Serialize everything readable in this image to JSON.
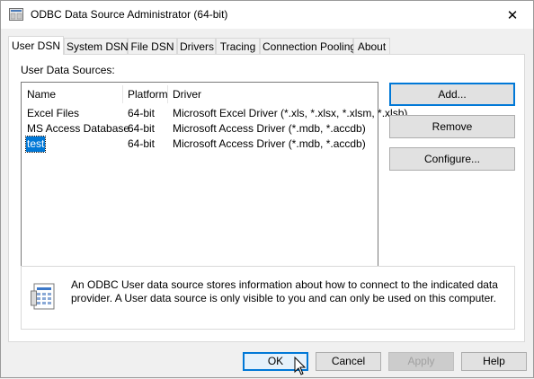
{
  "window": {
    "title": "ODBC Data Source Administrator (64-bit)",
    "close_label": "✕"
  },
  "tabs": [
    {
      "label": "User DSN",
      "active": true
    },
    {
      "label": "System DSN",
      "active": false
    },
    {
      "label": "File DSN",
      "active": false
    },
    {
      "label": "Drivers",
      "active": false
    },
    {
      "label": "Tracing",
      "active": false
    },
    {
      "label": "Connection Pooling",
      "active": false
    },
    {
      "label": "About",
      "active": false
    }
  ],
  "panel": {
    "section_label": "User Data Sources:",
    "columns": [
      "Name",
      "Platform",
      "Driver"
    ],
    "rows": [
      {
        "name": "Excel Files",
        "platform": "64-bit",
        "driver": "Microsoft Excel Driver (*.xls, *.xlsx, *.xlsm, *.xlsb)"
      },
      {
        "name": "MS Access Database",
        "platform": "64-bit",
        "driver": "Microsoft Access Driver (*.mdb, *.accdb)"
      },
      {
        "name": "test",
        "platform": "64-bit",
        "driver": "Microsoft Access Driver (*.mdb, *.accdb)",
        "selected": true
      }
    ],
    "buttons": {
      "add": "Add...",
      "remove": "Remove",
      "configure": "Configure..."
    },
    "info_text": "An ODBC User data source stores information about how to connect to the indicated data provider.   A User data source is only visible to you and can only be used on this computer."
  },
  "footer": {
    "ok": "OK",
    "cancel": "Cancel",
    "apply": "Apply",
    "help": "Help"
  },
  "colors": {
    "accent": "#0078d7",
    "selection": "#0078d7"
  },
  "icons": [
    "app-icon",
    "close-icon",
    "scroll-left-icon",
    "scroll-right-icon",
    "info-document-icon",
    "mouse-cursor-icon"
  ]
}
